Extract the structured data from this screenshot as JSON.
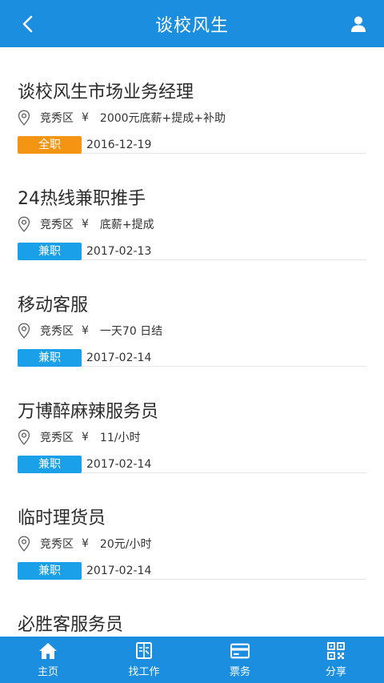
{
  "header": {
    "title": "谈校风生"
  },
  "jobs": [
    {
      "title": "谈校风生市场业务经理",
      "district": "竞秀区",
      "currency": "¥",
      "salary": "2000元底薪+提成+补助",
      "type": "全职",
      "type_kind": "full",
      "date": "2016-12-19"
    },
    {
      "title": "24热线兼职推手",
      "district": "竞秀区",
      "currency": "¥",
      "salary": "底薪+提成",
      "type": "兼职",
      "type_kind": "part",
      "date": "2017-02-13"
    },
    {
      "title": "移动客服",
      "district": "竞秀区",
      "currency": "¥",
      "salary": "一天70 日结",
      "type": "兼职",
      "type_kind": "part",
      "date": "2017-02-14"
    },
    {
      "title": "万博醉麻辣服务员",
      "district": "竞秀区",
      "currency": "¥",
      "salary": "11/小时",
      "type": "兼职",
      "type_kind": "part",
      "date": "2017-02-14"
    },
    {
      "title": "临时理货员",
      "district": "竞秀区",
      "currency": "¥",
      "salary": "20元/小时",
      "type": "兼职",
      "type_kind": "part",
      "date": "2017-02-14"
    },
    {
      "title": "必胜客服务员"
    }
  ],
  "bottom_nav": [
    {
      "label": "主页",
      "icon": "home-icon"
    },
    {
      "label": "找工作",
      "icon": "find-job-icon"
    },
    {
      "label": "票务",
      "icon": "ticket-icon"
    },
    {
      "label": "分享",
      "icon": "qr-code-icon"
    }
  ],
  "colors": {
    "primary": "#1b8ee0",
    "full_time_tag": "#f39512",
    "part_time_tag": "#1aa0e8"
  }
}
